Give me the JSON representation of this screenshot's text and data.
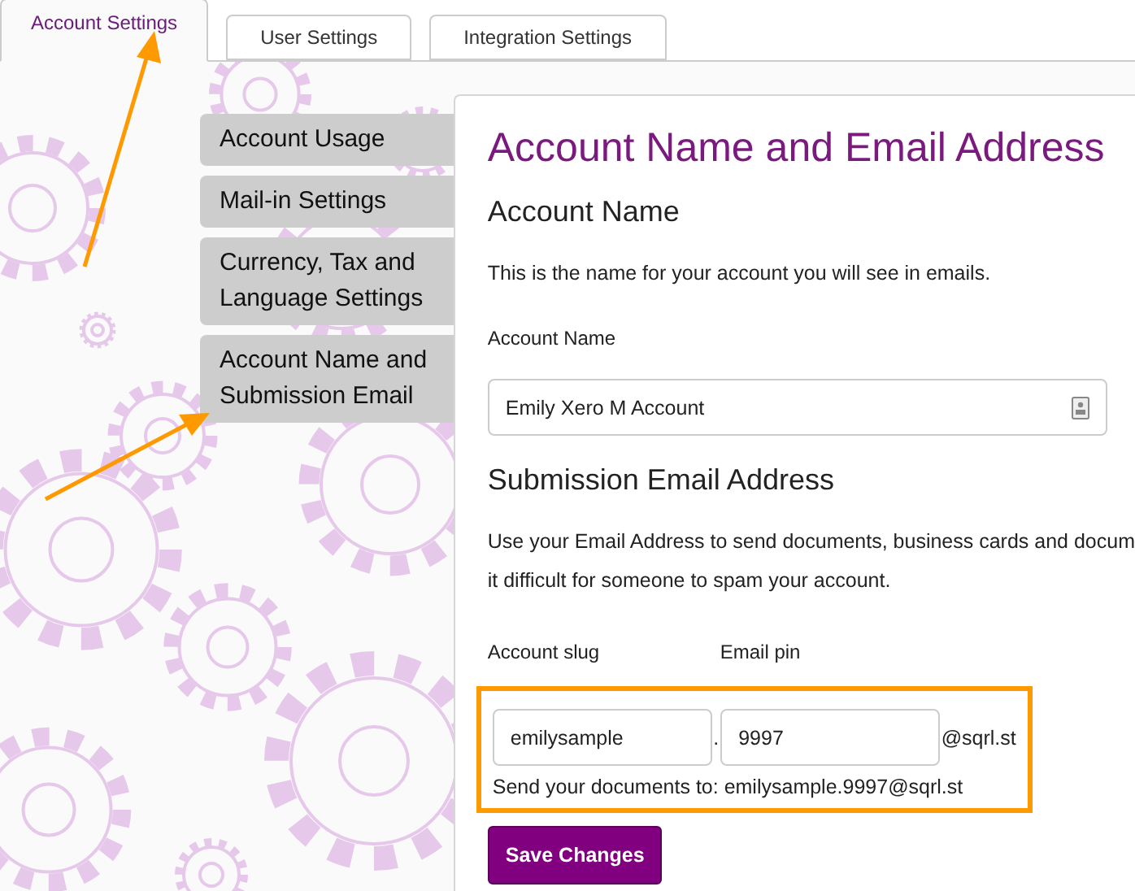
{
  "tabs": [
    {
      "label": "Account Settings",
      "selected": true
    },
    {
      "label": "User Settings",
      "selected": false
    },
    {
      "label": "Integration Settings",
      "selected": false
    }
  ],
  "sidebar": {
    "items": [
      {
        "label": "Account Usage"
      },
      {
        "label": "Mail-in Settings"
      },
      {
        "label": "Currency, Tax and Language Settings"
      },
      {
        "label": "Account Name and Submission Email"
      }
    ]
  },
  "panel": {
    "title": "Account Name and Email Address",
    "account_name": {
      "heading": "Account Name",
      "description": "This is the name for your account you will see in emails.",
      "label": "Account Name",
      "value": "Emily Xero M Account"
    },
    "submission_email": {
      "heading": "Submission Email Address",
      "description_line_1": "Use your Email Address to send documents, business cards and docum",
      "description_line_2": "it difficult for someone to spam your account.",
      "slug_label": "Account slug",
      "pin_label": "Email pin",
      "slug_value": "emilysample",
      "separator": ".",
      "pin_value": "9997",
      "domain": "@sqrl.st",
      "highlighted": true,
      "summary": "Send your documents to: emilysample.9997@sqrl.st"
    },
    "save_button": "Save Changes"
  }
}
